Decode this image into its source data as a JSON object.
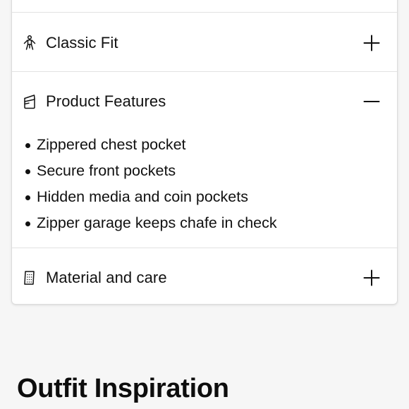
{
  "accordion": {
    "items": [
      {
        "title": "Classic Fit",
        "icon": "person-fit-icon",
        "expanded": false
      },
      {
        "title": "Product Features",
        "icon": "shopping-bag-icon",
        "expanded": true,
        "bullets": [
          "Zippered chest pocket",
          "Secure front pockets",
          "Hidden media and coin pockets",
          "Zipper garage keeps chafe in check"
        ]
      },
      {
        "title": "Material and care",
        "icon": "fabric-tag-icon",
        "expanded": false
      }
    ]
  },
  "inspiration": {
    "title": "Outfit Inspiration"
  },
  "colors": {
    "page_background": "#f6f6f6",
    "card_background": "#ffffff",
    "text": "#111111",
    "divider": "#e2e2e2"
  }
}
